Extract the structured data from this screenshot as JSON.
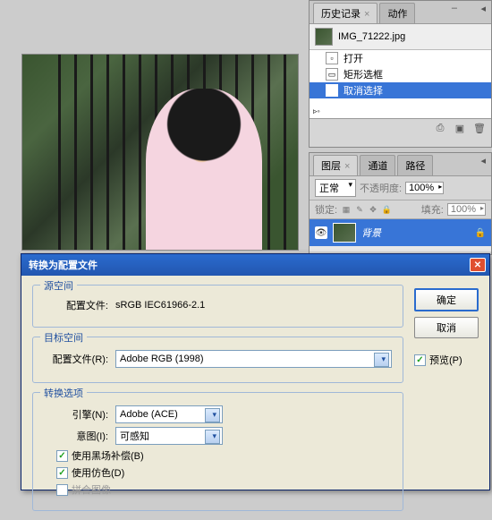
{
  "history": {
    "tab_history": "历史记录",
    "tab_actions": "动作",
    "document": "IMG_71222.jpg",
    "items": [
      "打开",
      "矩形选框",
      "取消选择"
    ]
  },
  "layers": {
    "tab_layers": "图层",
    "tab_channels": "通道",
    "tab_paths": "路径",
    "blend_mode": "正常",
    "opacity_label": "不透明度:",
    "opacity_value": "100%",
    "lock_label": "锁定:",
    "fill_label": "填充:",
    "fill_value": "100%",
    "layer_name": "背景"
  },
  "dialog": {
    "title": "转换为配置文件",
    "source_legend": "源空间",
    "profile_label": "配置文件:",
    "source_profile": "sRGB IEC61966-2.1",
    "dest_legend": "目标空间",
    "dest_profile_label": "配置文件(R):",
    "dest_profile": "Adobe RGB (1998)",
    "options_legend": "转换选项",
    "engine_label": "引擎(N):",
    "engine_value": "Adobe (ACE)",
    "intent_label": "意图(I):",
    "intent_value": "可感知",
    "blackpoint": "使用黑场补偿(B)",
    "dither": "使用仿色(D)",
    "flatten": "拼合图像",
    "ok": "确定",
    "cancel": "取消",
    "preview": "预览(P)"
  }
}
